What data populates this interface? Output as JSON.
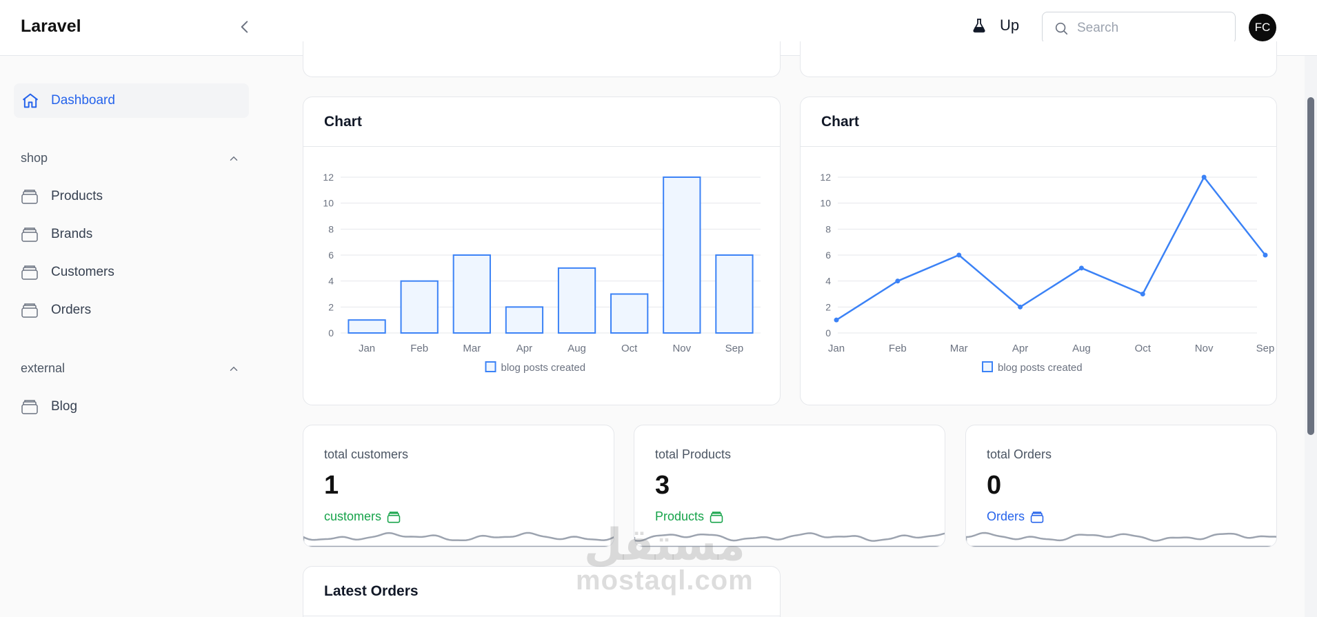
{
  "header": {
    "brand": "Laravel",
    "env_label": "Up",
    "search_placeholder": "Search",
    "avatar_initials": "FC"
  },
  "sidebar": {
    "active": {
      "label": "Dashboard",
      "icon": "home-icon"
    },
    "groups": [
      {
        "label": "shop",
        "items": [
          "Products",
          "Brands",
          "Customers",
          "Orders"
        ]
      },
      {
        "label": "external",
        "items": [
          "Blog"
        ]
      }
    ]
  },
  "charts": {
    "bar_title": "Chart",
    "line_title": "Chart"
  },
  "chart_data": [
    {
      "type": "bar",
      "title": "Chart",
      "categories": [
        "Jan",
        "Feb",
        "Mar",
        "Apr",
        "Aug",
        "Oct",
        "Nov",
        "Sep"
      ],
      "series": [
        {
          "name": "blog posts created",
          "values": [
            1,
            4,
            6,
            2,
            5,
            3,
            12,
            6
          ]
        }
      ],
      "ylim": [
        0,
        12
      ],
      "yticks": [
        0,
        2,
        4,
        6,
        8,
        10,
        12
      ],
      "grid": true,
      "legend": "bottom",
      "color": "#3b82f6"
    },
    {
      "type": "line",
      "title": "Chart",
      "categories": [
        "Jan",
        "Feb",
        "Mar",
        "Apr",
        "Aug",
        "Oct",
        "Nov",
        "Sep"
      ],
      "series": [
        {
          "name": "blog posts created",
          "values": [
            1,
            4,
            6,
            2,
            5,
            3,
            12,
            6
          ]
        }
      ],
      "ylim": [
        0,
        12
      ],
      "yticks": [
        0,
        2,
        4,
        6,
        8,
        10,
        12
      ],
      "grid": true,
      "legend": "bottom",
      "color": "#3b82f6"
    }
  ],
  "stats": [
    {
      "label": "total customers",
      "value": "1",
      "link": "customers",
      "color": "#16a34a"
    },
    {
      "label": "total Products",
      "value": "3",
      "link": "Products",
      "color": "#16a34a"
    },
    {
      "label": "total Orders",
      "value": "0",
      "link": "Orders",
      "color": "#2563eb"
    }
  ],
  "latest_orders": {
    "title": "Latest Orders"
  },
  "watermark": {
    "arabic": "مستقل",
    "latin": "mostaql.com"
  }
}
